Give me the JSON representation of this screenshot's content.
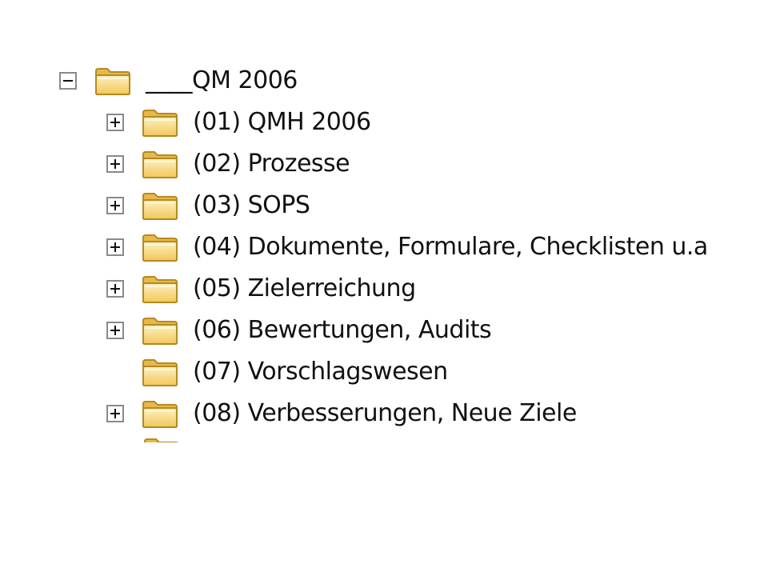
{
  "colors": {
    "folder_fill": "#f3d071",
    "folder_light": "#fbe9a6",
    "folder_stroke": "#b58a1f",
    "toggle_border": "#8a8a8a"
  },
  "tree": {
    "root": {
      "label": "____QM 2006",
      "state": "expanded",
      "icon": "folder-icon"
    },
    "children": [
      {
        "label": "(01) QMH 2006",
        "has_toggle": true,
        "state": "collapsed"
      },
      {
        "label": "(02) Prozesse",
        "has_toggle": true,
        "state": "collapsed"
      },
      {
        "label": "(03) SOPS",
        "has_toggle": true,
        "state": "collapsed"
      },
      {
        "label": "(04) Dokumente, Formulare, Checklisten u.a",
        "has_toggle": true,
        "state": "collapsed"
      },
      {
        "label": "(05) Zielerreichung",
        "has_toggle": true,
        "state": "collapsed"
      },
      {
        "label": "(06) Bewertungen, Audits",
        "has_toggle": true,
        "state": "collapsed"
      },
      {
        "label": "(07) Vorschlagswesen",
        "has_toggle": false,
        "state": "none"
      },
      {
        "label": "(08) Verbesserungen, Neue Ziele",
        "has_toggle": true,
        "state": "collapsed"
      }
    ]
  }
}
